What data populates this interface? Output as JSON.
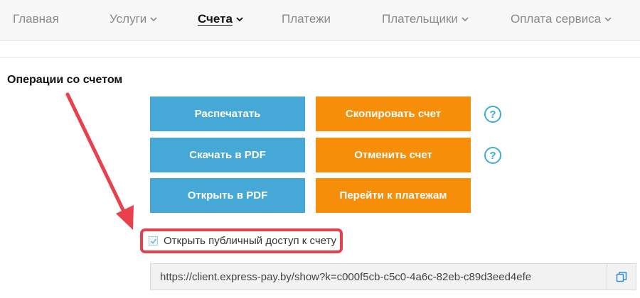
{
  "nav": {
    "items": [
      {
        "label": "Главная",
        "dropdown": false,
        "active": false
      },
      {
        "label": "Услуги",
        "dropdown": true,
        "active": false
      },
      {
        "label": "Счета",
        "dropdown": true,
        "active": true
      },
      {
        "label": "Платежи",
        "dropdown": false,
        "active": false
      },
      {
        "label": "Плательщики",
        "dropdown": true,
        "active": false
      },
      {
        "label": "Оплата сервиса",
        "dropdown": true,
        "active": false
      }
    ]
  },
  "operations": {
    "title": "Операции со счетом",
    "buttons": {
      "print": "Распечатать",
      "download_pdf": "Скачать в PDF",
      "open_pdf": "Открыть в PDF",
      "copy_invoice": "Скопировать счет",
      "cancel_invoice": "Отменить счет",
      "go_to_payments": "Перейти к платежам"
    },
    "help_symbol": "?"
  },
  "public_access": {
    "label": "Открыть публичный доступ к счету",
    "checked": true
  },
  "public_link": {
    "value": "https://client.express-pay.by/show?k=c000f5cb-c5c0-4a6c-82eb-c89d3eed4efe",
    "copy_icon": "copy-icon"
  },
  "colors": {
    "blue_button": "#45a8d6",
    "orange_button": "#f68e0a",
    "help_icon": "#3aaed8",
    "highlight": "#e8414d"
  }
}
